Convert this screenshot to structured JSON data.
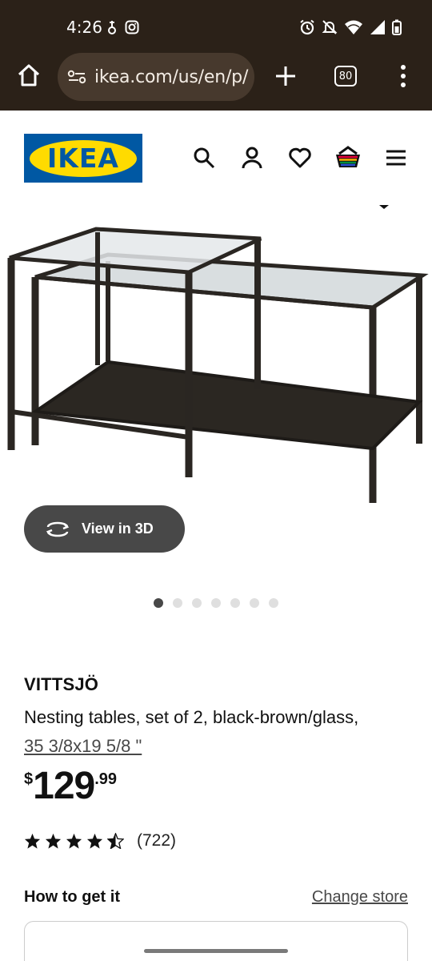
{
  "status_bar": {
    "time": "4:26",
    "left_icons": [
      "thermometer-icon",
      "instagram-icon"
    ],
    "right_icons": [
      "alarm-icon",
      "mute-icon",
      "wifi-icon",
      "signal-icon",
      "battery-icon"
    ]
  },
  "browser": {
    "url": "ikea.com/us/en/p/",
    "tab_count": "80",
    "buttons": [
      "home-icon",
      "site-settings-icon",
      "new-tab-icon",
      "tabs-icon",
      "more-menu-icon"
    ]
  },
  "header": {
    "logo_text": "IKEA",
    "icons": [
      "search-icon",
      "account-icon",
      "favorites-icon",
      "cart-icon",
      "hamburger-menu-icon"
    ]
  },
  "gallery": {
    "view_3d_label": "View in 3D",
    "image_count": 7,
    "active_image": 1
  },
  "product": {
    "name": "VITTSJÖ",
    "description": "Nesting tables, set of 2, black-brown/glass,",
    "size": "35 3/8x19 5/8 \"",
    "price_currency": "$",
    "price_integer": "129",
    "price_decimals": ".99",
    "rating": 4.5,
    "review_count": "(722)"
  },
  "fulfillment": {
    "title": "How to get it",
    "change_store_label": "Change store"
  },
  "colors": {
    "chrome_bg": "#2b2118",
    "url_pill_bg": "#47392d",
    "ikea_blue": "#0058a3",
    "ikea_yellow": "#ffdb00",
    "button_dark": "#484848"
  }
}
